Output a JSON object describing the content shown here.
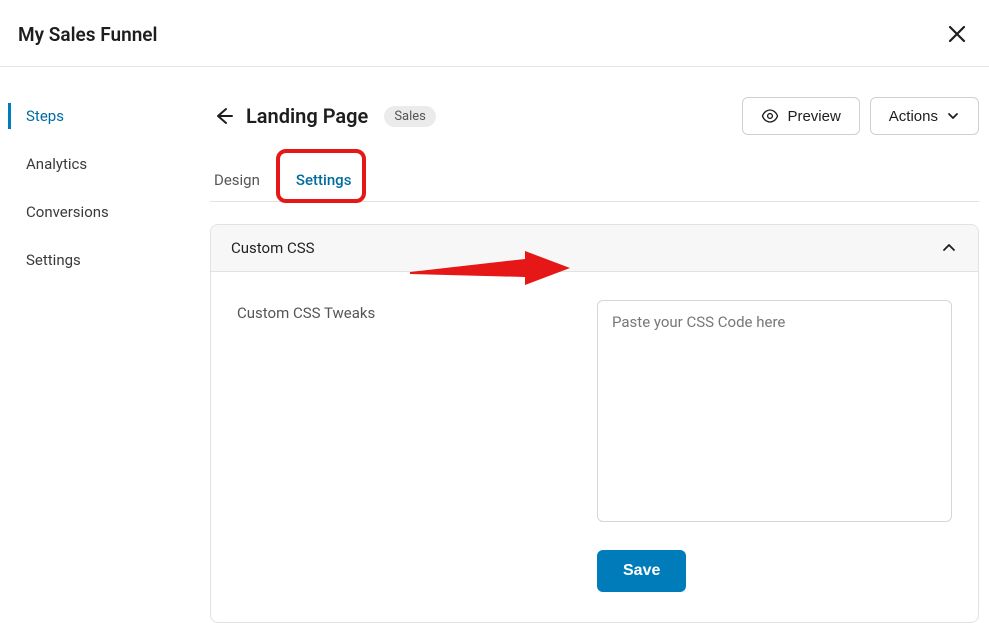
{
  "topbar": {
    "title": "My Sales Funnel"
  },
  "sidebar": {
    "items": [
      {
        "label": "Steps",
        "active": true
      },
      {
        "label": "Analytics",
        "active": false
      },
      {
        "label": "Conversions",
        "active": false
      },
      {
        "label": "Settings",
        "active": false
      }
    ]
  },
  "header": {
    "title": "Landing Page",
    "badge": "Sales",
    "preview_label": "Preview",
    "actions_label": "Actions"
  },
  "tabs": {
    "items": [
      {
        "label": "Design",
        "active": false
      },
      {
        "label": "Settings",
        "active": true
      }
    ]
  },
  "panel": {
    "title": "Custom CSS",
    "field_label": "Custom CSS Tweaks",
    "textarea_placeholder": "Paste your CSS Code here",
    "textarea_value": "",
    "save_label": "Save"
  }
}
